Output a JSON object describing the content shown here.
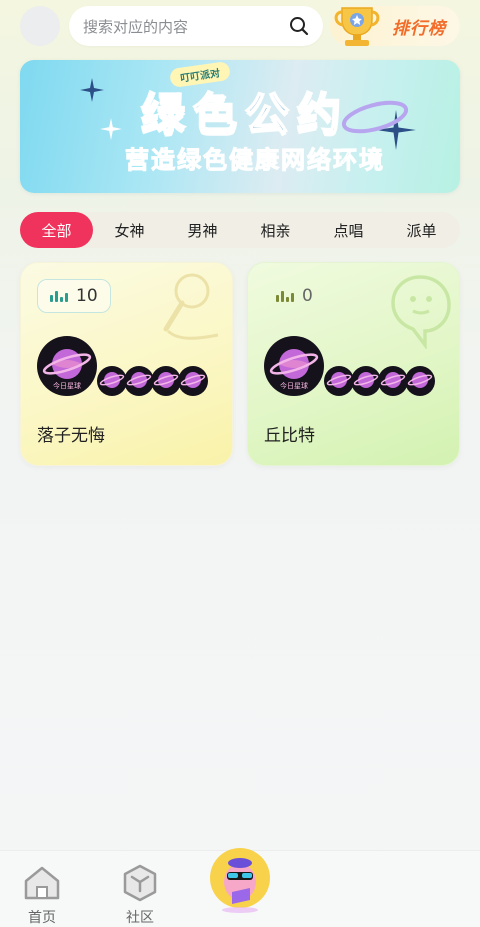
{
  "header": {
    "search_placeholder": "搜索对应的内容",
    "rank_label": "排行榜"
  },
  "banner": {
    "tag": "叮叮派对",
    "title": "绿色公约",
    "subtitle": "营造绿色健康网络环境"
  },
  "tabs": [
    "全部",
    "女神",
    "男神",
    "相亲",
    "点唱",
    "派单"
  ],
  "active_tab": 0,
  "rooms": [
    {
      "count": "10",
      "name": "落子无悔",
      "theme": "karaoke"
    },
    {
      "count": "0",
      "name": "丘比特",
      "theme": "chat"
    }
  ],
  "seat_label": "今日星球",
  "bottom_nav": [
    {
      "label": "首页",
      "icon": "home-icon"
    },
    {
      "label": "社区",
      "icon": "community-cube-icon"
    }
  ],
  "colors": {
    "accent": "#f0335c",
    "rank_text": "#f26c2a",
    "card_yellow": "#f9f2a9",
    "card_green": "#d3f2b1"
  }
}
